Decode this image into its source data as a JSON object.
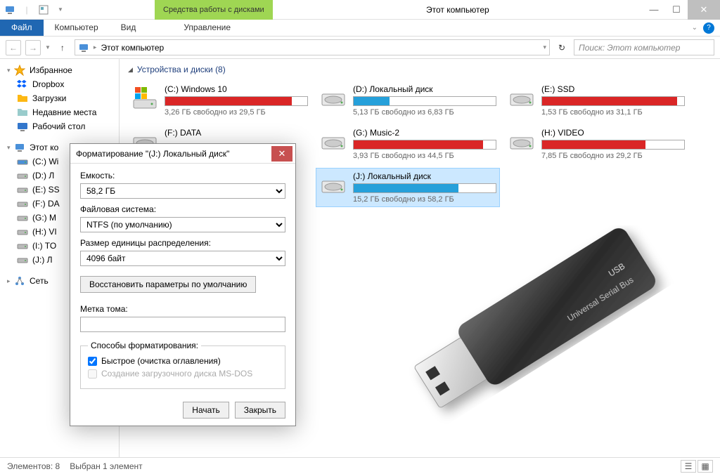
{
  "window": {
    "title": "Этот компьютер",
    "ribbon_context": "Средства работы с дисками"
  },
  "ribbon": {
    "file": "Файл",
    "computer": "Компьютер",
    "view": "Вид",
    "manage": "Управление"
  },
  "nav": {
    "breadcrumb": "Этот компьютер",
    "search_placeholder": "Поиск: Этот компьютер"
  },
  "sidebar": {
    "favorites": "Избранное",
    "items_fav": [
      {
        "label": "Dropbox"
      },
      {
        "label": "Загрузки"
      },
      {
        "label": "Недавние места"
      },
      {
        "label": "Рабочий стол"
      }
    ],
    "this_pc": "Этот ко",
    "drives_side": [
      "(C:) Wi",
      "(D:) Л",
      "(E:) SS",
      "(F:) DA",
      "(G:) M",
      "(H:) VI",
      "(I:) TO",
      "(J:) Л"
    ],
    "network": "Сеть"
  },
  "content": {
    "section": "Устройства и диски (8)"
  },
  "drives": [
    {
      "name": "(C:) Windows 10",
      "status": "3,26 ГБ свободно из 29,5 ГБ",
      "fill": 89,
      "color": "red",
      "type": "win"
    },
    {
      "name": "(D:) Локальный диск",
      "status": "5,13 ГБ свободно из 6,83 ГБ",
      "fill": 25,
      "color": "blue",
      "type": "hdd"
    },
    {
      "name": "(E:) SSD",
      "status": "1,53 ГБ свободно из 31,1 ГБ",
      "fill": 95,
      "color": "red",
      "type": "hdd"
    },
    {
      "name": "(F:) DATA",
      "status": "",
      "fill": 0,
      "color": "",
      "type": "hdd"
    },
    {
      "name": "(G:) Music-2",
      "status": "3,93 ГБ свободно из 44,5 ГБ",
      "fill": 91,
      "color": "red",
      "type": "hdd"
    },
    {
      "name": "(H:) VIDEO",
      "status": "7,85 ГБ свободно из 29,2 ГБ",
      "fill": 73,
      "color": "red",
      "type": "hdd"
    },
    {
      "name": "",
      "status": "",
      "fill": 0,
      "color": "",
      "type": ""
    },
    {
      "name": "(J:) Локальный диск",
      "status": "15,2 ГБ свободно из 58,2 ГБ",
      "fill": 74,
      "color": "blue",
      "type": "hdd",
      "selected": true
    }
  ],
  "dialog": {
    "title": "Форматирование \"(J:) Локальный диск\"",
    "capacity_label": "Емкость:",
    "capacity_value": "58,2 ГБ",
    "fs_label": "Файловая система:",
    "fs_value": "NTFS (по умолчанию)",
    "alloc_label": "Размер единицы распределения:",
    "alloc_value": "4096 байт",
    "restore_btn": "Восстановить параметры по умолчанию",
    "volume_label": "Метка тома:",
    "options_legend": "Способы форматирования:",
    "quick_format": "Быстрое (очистка оглавления)",
    "msdos": "Создание загрузочного диска MS-DOS",
    "start": "Начать",
    "close": "Закрыть"
  },
  "statusbar": {
    "items": "Элементов: 8",
    "selected": "Выбран 1 элемент"
  },
  "usb": {
    "label1": "USB",
    "label2": "Universal Serial Bus"
  }
}
